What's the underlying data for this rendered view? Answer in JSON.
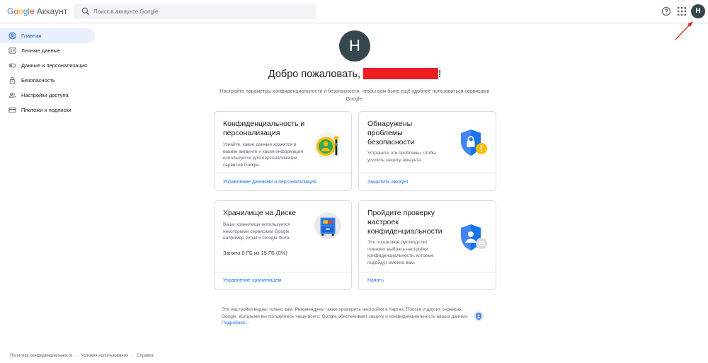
{
  "header": {
    "logo_letters": [
      "G",
      "o",
      "o",
      "g",
      "l",
      "e"
    ],
    "product": "Аккаунт",
    "search_placeholder": "Поиск в аккаунте Google",
    "avatar_letter": "H"
  },
  "sidebar": {
    "items": [
      {
        "label": "Главная",
        "icon": "home-person-icon",
        "active": true
      },
      {
        "label": "Личные данные",
        "icon": "id-card-icon",
        "active": false
      },
      {
        "label": "Данные и персонализация",
        "icon": "toggle-icon",
        "active": false
      },
      {
        "label": "Безопасность",
        "icon": "lock-icon",
        "active": false
      },
      {
        "label": "Настройки доступа",
        "icon": "people-icon",
        "active": false
      },
      {
        "label": "Платежи и подписки",
        "icon": "credit-card-icon",
        "active": false
      }
    ]
  },
  "main": {
    "avatar_letter": "H",
    "welcome": "Добро пожаловать,",
    "welcome_suffix": "!",
    "subtitle": "Настройте параметры конфиденциальности и безопасности, чтобы вам было ещё удобнее пользоваться сервисами Google."
  },
  "cards": {
    "privacy": {
      "title": "Конфиденциальность и персонализация",
      "desc": "Узнайте, какие данные хранятся в вашем аккаунте и какая информация используется для персонализации сервисов Google.",
      "link": "Управление данными и персонализация"
    },
    "security": {
      "title": "Обнаружены проблемы безопасности",
      "desc": "Устраните эти проблемы, чтобы усилить защиту аккаунта",
      "link": "Защитить аккаунт"
    },
    "storage": {
      "title": "Хранилище на Диске",
      "desc": "Ваше хранилище используется некоторыми сервисами Google, например Gmail и Google Фото.",
      "usage": "Занято 0 ГБ из 15 ГБ (0%)",
      "link": "Управление хранилищем"
    },
    "checkup": {
      "title": "Пройдите проверку настроек конфиденциальности",
      "desc": "Это пошаговое руководство поможет выбрать настройки конфиденциальности, которые подойдут именно вам.",
      "link": "Начать"
    }
  },
  "footnote": {
    "text": "Эти настройки видны только вам. Рекомендуем также проверить настройки в Картах, Поиске и других сервисах Google, которыми вы пользуетесь чаще всего. Google обеспечивает защиту и конфиденциальность ваших данных.",
    "link": "Подробнее…"
  },
  "footer": {
    "links": [
      "Политика конфиденциальности",
      "Условия использования",
      "Справка"
    ]
  },
  "colors": {
    "accent": "#1a73e8",
    "avatar_bg": "#37474f",
    "redaction": "#ee1c25"
  }
}
